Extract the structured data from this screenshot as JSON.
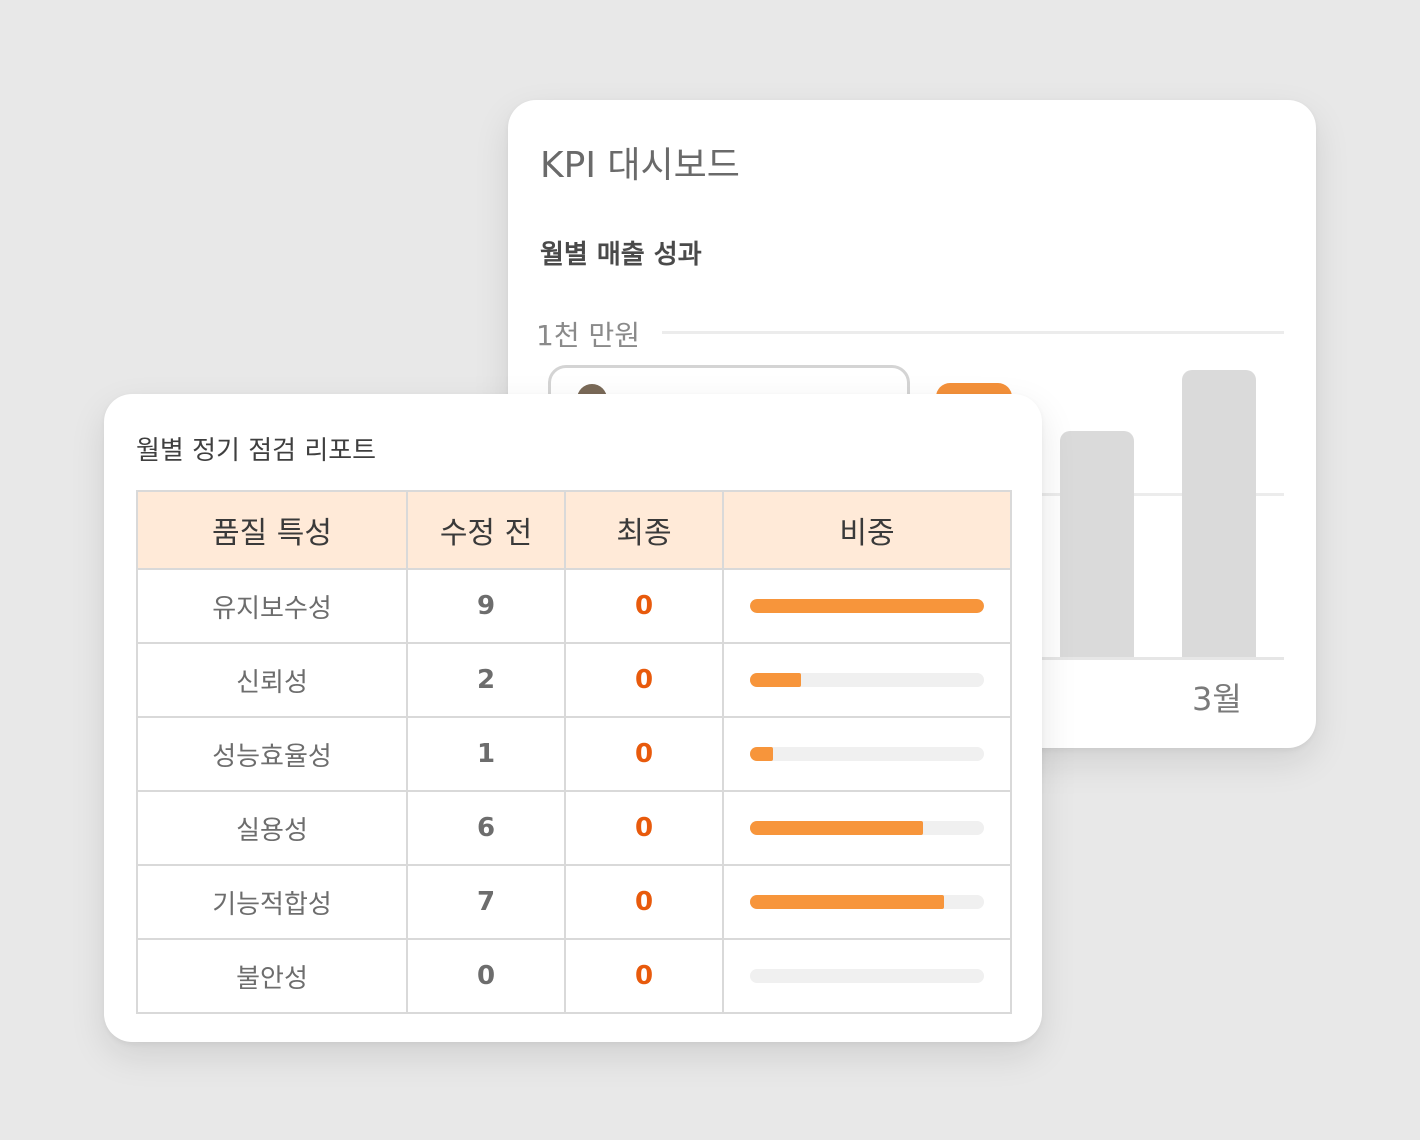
{
  "kpi": {
    "title": "KPI 대시보드",
    "subtitle": "월별 매출 성과",
    "unit_label": "1천 만원",
    "visible_month_label": "3월"
  },
  "report": {
    "title": "월별 정기 점검 리포트",
    "columns": [
      "품질 특성",
      "수정 전",
      "최종",
      "비중"
    ],
    "rows": [
      {
        "name": "유지보수성",
        "before": "9",
        "final": "0",
        "share": 1.0
      },
      {
        "name": "신뢰성",
        "before": "2",
        "final": "0",
        "share": 0.22
      },
      {
        "name": "성능효율성",
        "before": "1",
        "final": "0",
        "share": 0.1
      },
      {
        "name": "실용성",
        "before": "6",
        "final": "0",
        "share": 0.74
      },
      {
        "name": "기능적합성",
        "before": "7",
        "final": "0",
        "share": 0.83
      },
      {
        "name": "불안성",
        "before": "0",
        "final": "0",
        "share": 0.0
      }
    ]
  },
  "colors": {
    "accent": "#f7953b",
    "final_value": "#e85a0c",
    "header_bg": "#ffead8",
    "background": "#e8e8e8"
  }
}
